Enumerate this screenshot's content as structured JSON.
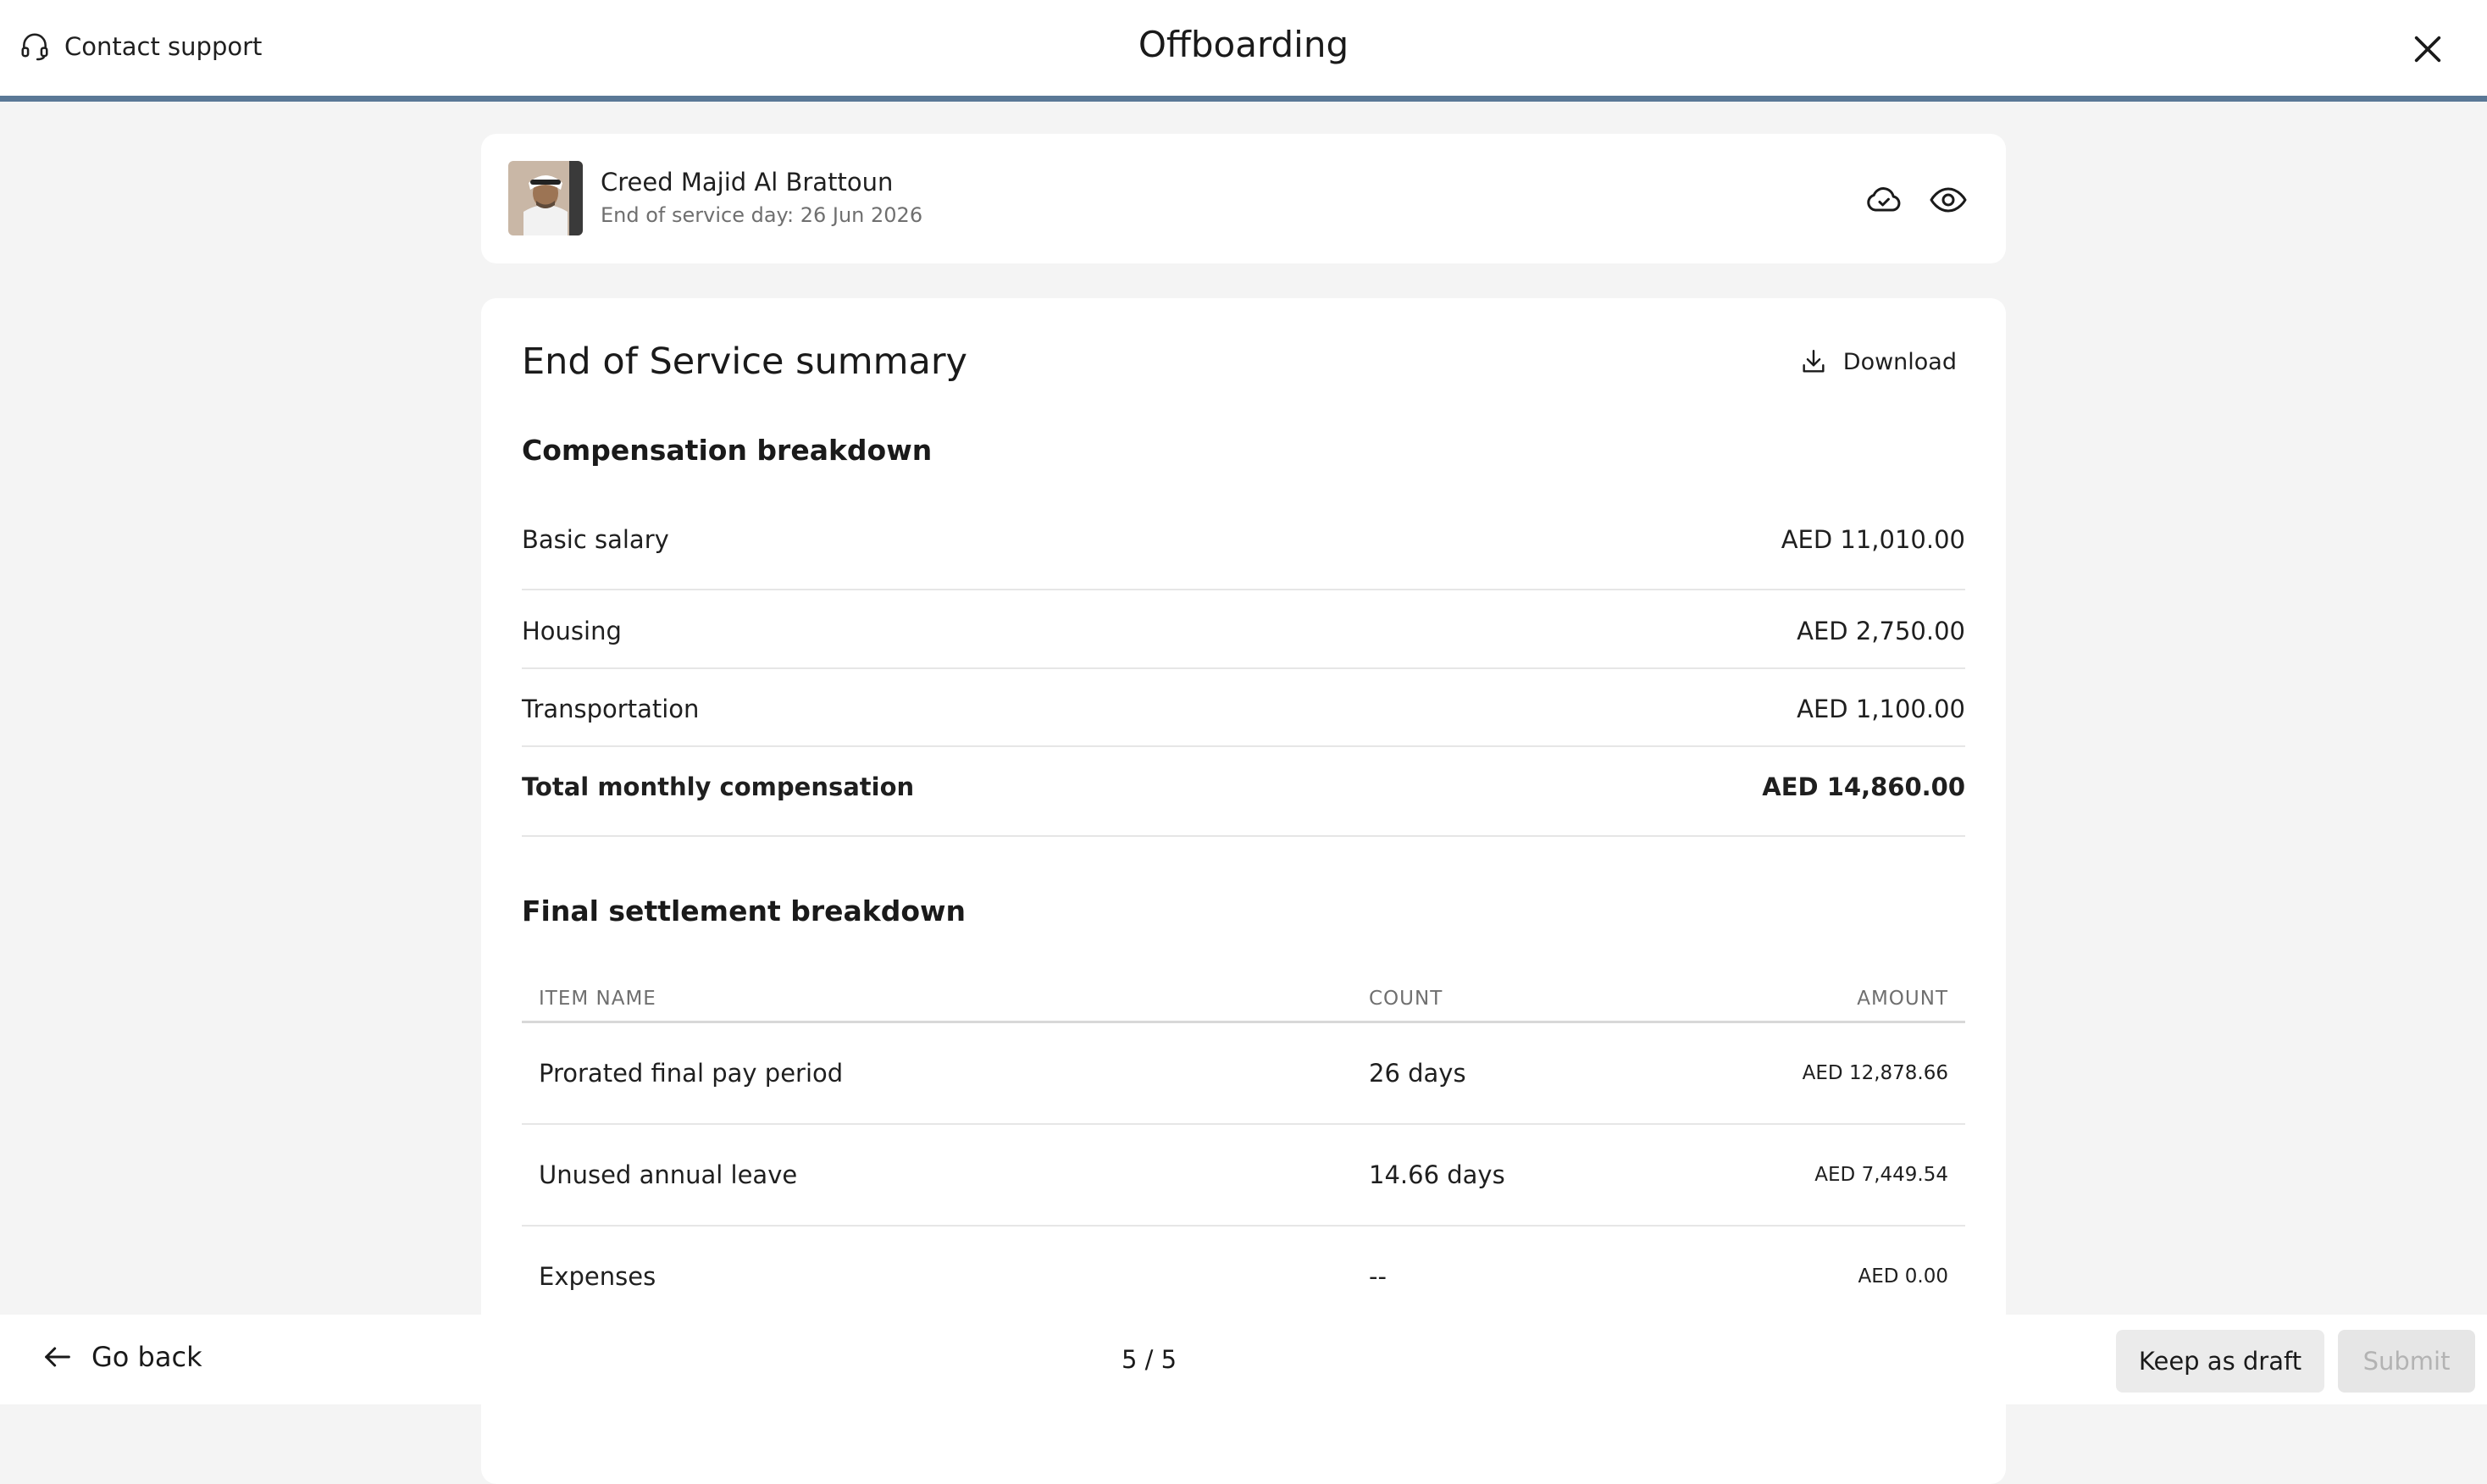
{
  "header": {
    "contact_support": "Contact support",
    "title": "Offboarding",
    "close_icon": "close-icon",
    "progress_color": "#5a7896"
  },
  "employee": {
    "name": "Creed Majid Al Brattoun",
    "end_of_service": "End of service day: 26 Jun 2026",
    "icons": [
      "cloud-check-icon",
      "eye-icon"
    ]
  },
  "summary": {
    "title": "End of Service summary",
    "download_label": "Download",
    "compensation": {
      "title": "Compensation breakdown",
      "rows": [
        {
          "label": "Basic salary",
          "value": "AED 11,010.00"
        },
        {
          "label": "Housing",
          "value": "AED 2,750.00"
        },
        {
          "label": "Transportation",
          "value": "AED 1,100.00"
        }
      ],
      "total": {
        "label": "Total monthly compensation",
        "value": "AED 14,860.00"
      }
    },
    "settlement": {
      "title": "Final settlement breakdown",
      "columns": [
        "ITEM NAME",
        "COUNT",
        "AMOUNT"
      ],
      "rows": [
        {
          "item": "Prorated final pay period",
          "count": "26 days",
          "amount": "AED 12,878.66"
        },
        {
          "item": "Unused annual leave",
          "count": "14.66 days",
          "amount": "AED 7,449.54"
        },
        {
          "item": "Expenses",
          "count": "--",
          "amount": "AED 0.00"
        }
      ]
    }
  },
  "footer": {
    "go_back": "Go back",
    "pager": "5 / 5",
    "keep_draft": "Keep as draft",
    "submit": "Submit"
  }
}
